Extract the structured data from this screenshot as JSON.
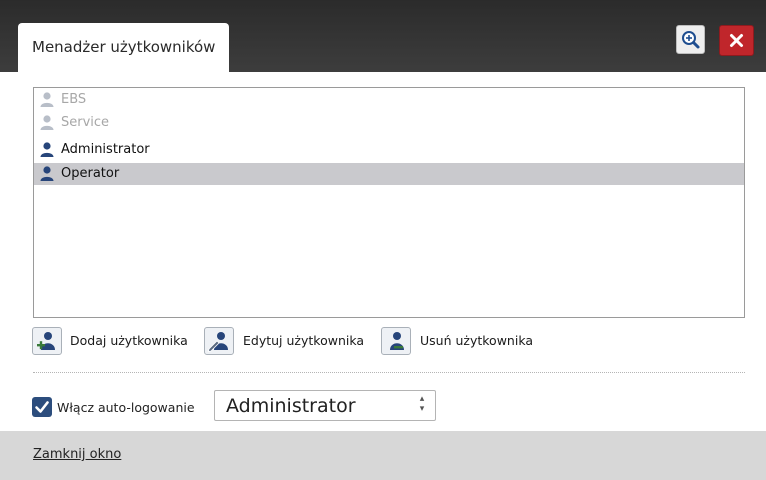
{
  "window": {
    "tab_title": "Menadżer użytkowników",
    "icons": {
      "zoom": "zoom-in-icon",
      "close": "close-icon"
    }
  },
  "users": [
    {
      "name": "EBS",
      "enabled": false,
      "selected": false
    },
    {
      "name": "Service",
      "enabled": false,
      "selected": false
    },
    {
      "name": "Administrator",
      "enabled": true,
      "selected": false
    },
    {
      "name": "Operator",
      "enabled": true,
      "selected": true
    }
  ],
  "actions": {
    "add_label": "Dodaj użytkownika",
    "edit_label": "Edytuj użytkownika",
    "delete_label": "Usuń użytkownika"
  },
  "autologin": {
    "checkbox_label": "Włącz auto-logowanie",
    "checked": true,
    "selected_user": "Administrator"
  },
  "footer": {
    "close_link": "Zamknij okno"
  },
  "colors": {
    "titlebar": "#333333",
    "close_button": "#c0262b",
    "user_icon_enabled": "#27457a",
    "user_icon_disabled": "#b8bec8",
    "selection": "#c9c9cd",
    "checkbox": "#2c4d7d",
    "footer": "#d7d7d7"
  }
}
